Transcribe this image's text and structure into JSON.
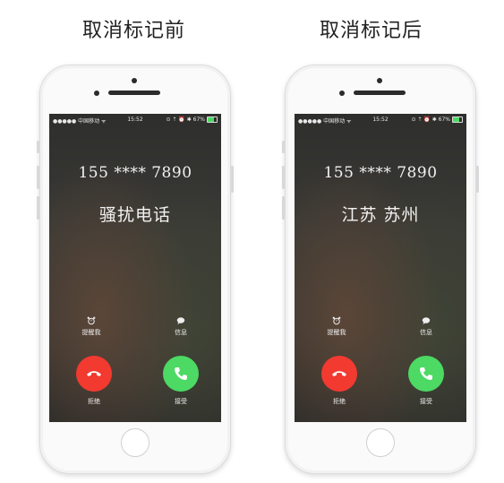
{
  "left": {
    "caption": "取消标记前",
    "status": {
      "carrier": "●●●●● 中国移动 ᯤ",
      "time": "15:52",
      "right": "⊙ ⇡ ⏰ ✱ 67%"
    },
    "number": "155 **** 7890",
    "subtitle": "骚扰电话",
    "remind_label": "提醒我",
    "message_label": "信息",
    "decline_label": "拒绝",
    "accept_label": "接受"
  },
  "right": {
    "caption": "取消标记后",
    "status": {
      "carrier": "●●●●● 中国移动 ᯤ",
      "time": "15:52",
      "right": "⊙ ⇡ ⏰ ✱ 67%"
    },
    "number": "155 **** 7890",
    "subtitle": "江苏 苏州",
    "remind_label": "提醒我",
    "message_label": "信息",
    "decline_label": "拒绝",
    "accept_label": "接受"
  },
  "battery_level": 0.67,
  "colors": {
    "decline": "#f23a30",
    "accept": "#4cd964",
    "battery": "#4cd964"
  },
  "icons": [
    "alarm-icon",
    "message-icon",
    "phone-hangup-icon",
    "phone-icon"
  ]
}
